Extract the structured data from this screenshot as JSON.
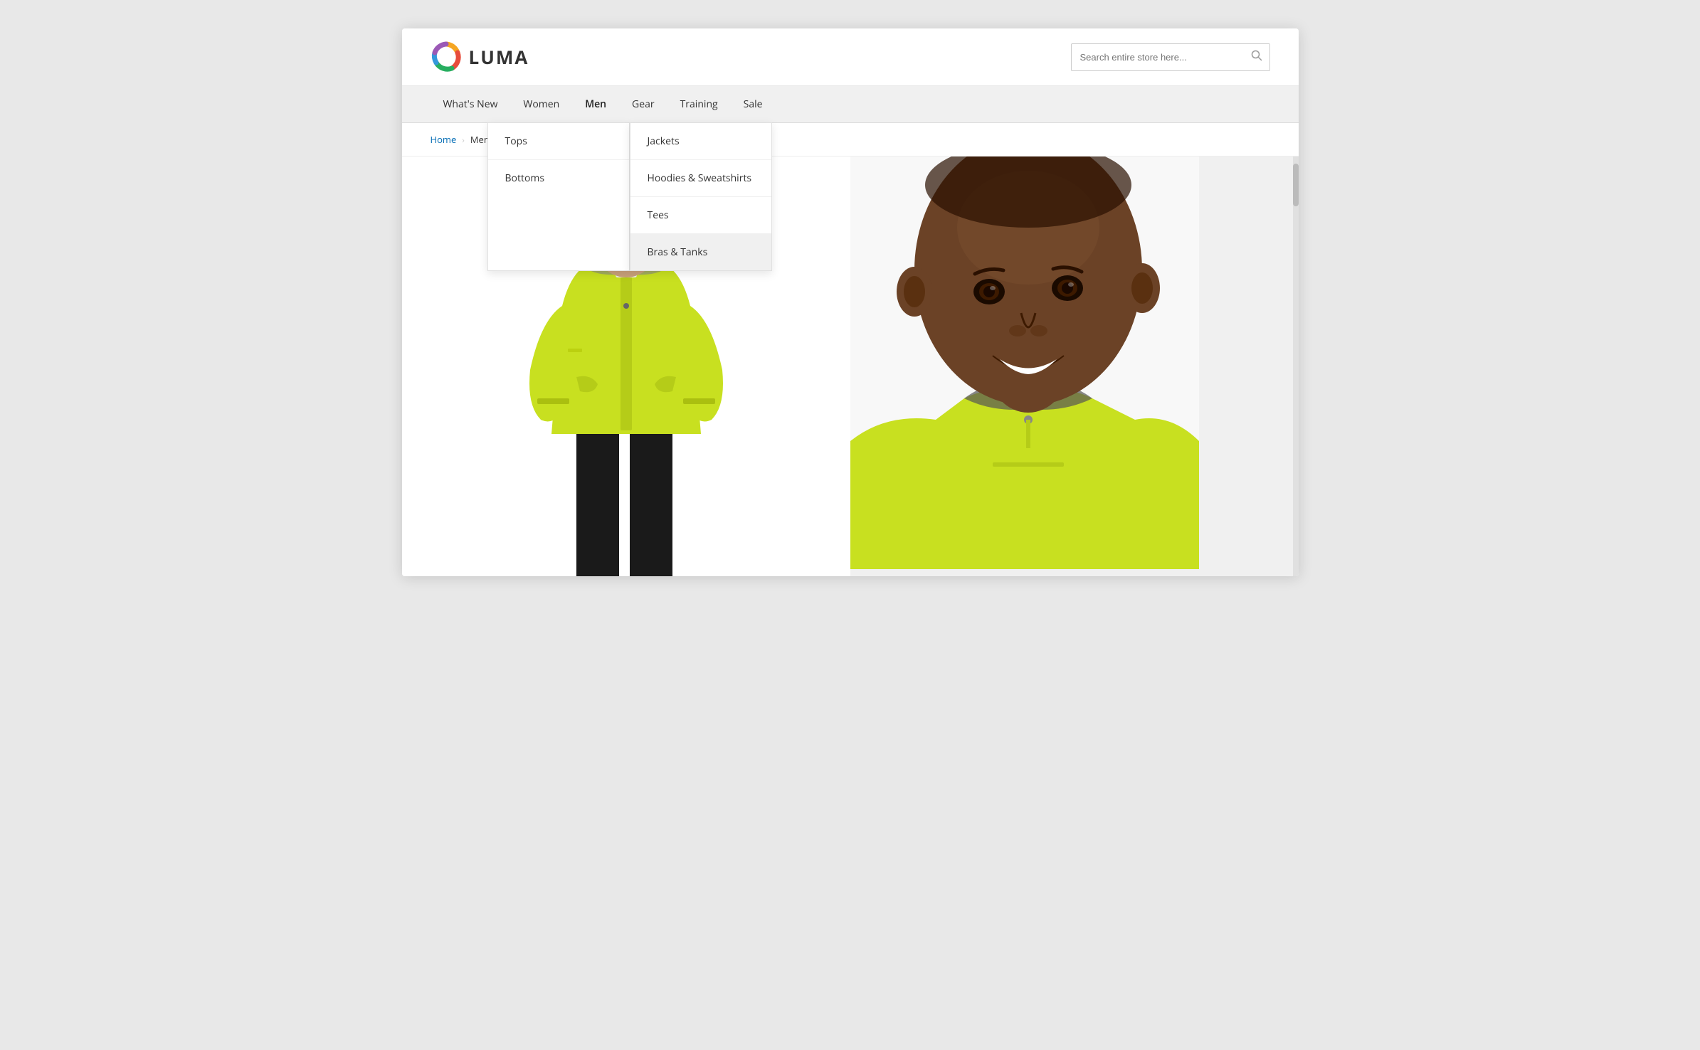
{
  "header": {
    "logo_text": "LUMA",
    "search_placeholder": "Search entire store here..."
  },
  "nav": {
    "items": [
      {
        "label": "What's New",
        "active": false
      },
      {
        "label": "Women",
        "active": false
      },
      {
        "label": "Men",
        "active": true
      },
      {
        "label": "Gear",
        "active": false
      },
      {
        "label": "Training",
        "active": false
      },
      {
        "label": "Sale",
        "active": false
      }
    ]
  },
  "dropdown": {
    "men_tops_col": {
      "items": [
        {
          "label": "Tops",
          "highlighted": false
        },
        {
          "label": "Bottoms",
          "highlighted": false
        }
      ]
    },
    "men_tops_sub_col": {
      "items": [
        {
          "label": "Jackets",
          "highlighted": false
        },
        {
          "label": "Hoodies & Sweatshirts",
          "highlighted": false
        },
        {
          "label": "Tees",
          "highlighted": false
        },
        {
          "label": "Bras & Tanks",
          "highlighted": true
        }
      ]
    }
  },
  "breadcrumb": {
    "home_label": "Home",
    "separator": "›",
    "current": "Men"
  },
  "colors": {
    "accent_blue": "#006bb4",
    "nav_bg": "#f0f0f0",
    "dropdown_bg": "#fff",
    "highlighted_bg": "#f0f0f0",
    "jacket_yellow": "#c8e020",
    "search_border": "#ccc"
  }
}
